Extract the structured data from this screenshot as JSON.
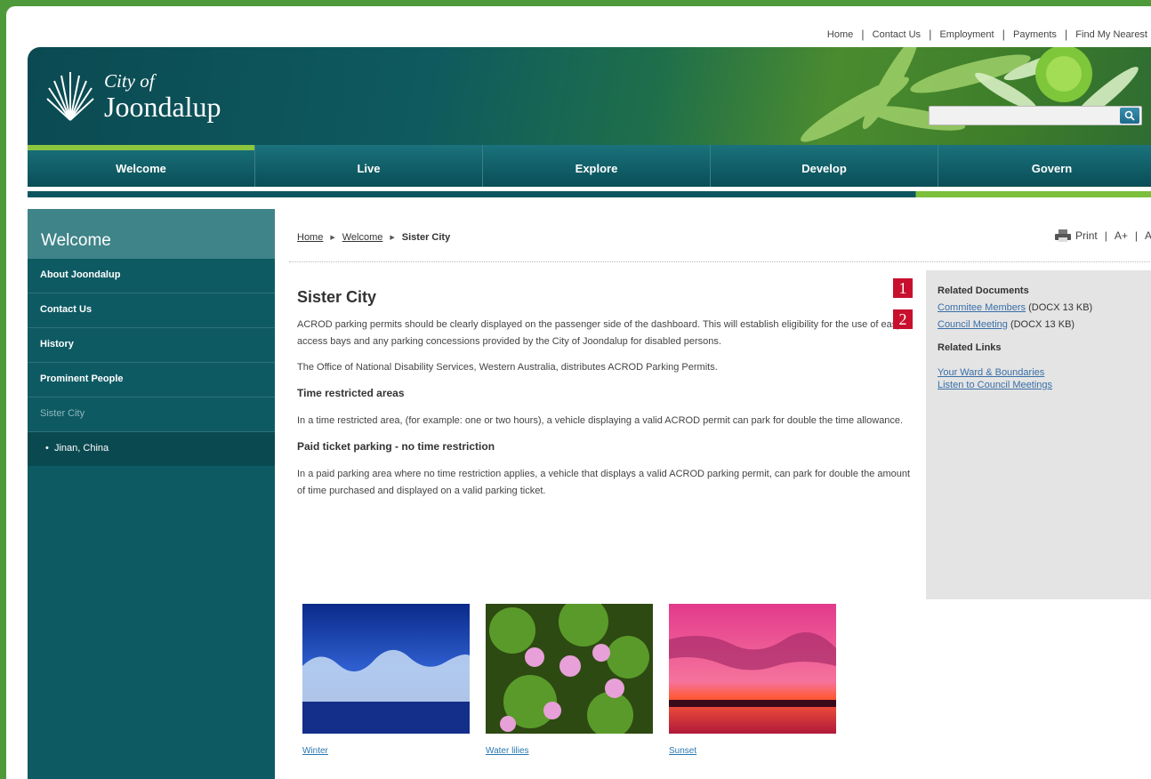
{
  "utility_nav": [
    "Home",
    "Contact Us",
    "Employment",
    "Payments",
    "Find My Nearest"
  ],
  "logo": {
    "line1": "City of",
    "line2": "Joondalup"
  },
  "search": {
    "placeholder": ""
  },
  "main_nav": [
    "Welcome",
    "Live",
    "Explore",
    "Develop",
    "Govern"
  ],
  "sidebar": {
    "title": "Welcome",
    "items": [
      "About Joondalup",
      "Contact Us",
      "History",
      "Prominent People",
      "Sister City"
    ],
    "sub_items": [
      "Jinan, China"
    ]
  },
  "breadcrumb": {
    "home": "Home",
    "welcome": "Welcome",
    "current": "Sister City"
  },
  "tools": {
    "print": "Print",
    "increase": "A+",
    "decrease": "A-"
  },
  "content": {
    "title": "Sister City",
    "p1": "ACROD parking permits should be clearly displayed on the passenger side of the dashboard. This will establish eligibility for the use of easy access bays and any parking concessions provided by the City of Joondalup for disabled persons.",
    "p2": "The Office of National Disability Services, Western Australia, distributes ACROD Parking Permits.",
    "h_time": "Time restricted areas",
    "p3": "In a time restricted area, (for example: one or two hours), a vehicle displaying a valid ACROD permit can park for double the time allowance.",
    "h_paid": "Paid ticket parking - no time restriction",
    "p4": "In a paid parking area where no time restriction applies, a vehicle that displays a valid ACROD parking permit, can park for double the amount of time purchased and displayed on a valid parking ticket."
  },
  "gallery": [
    "Winter",
    "Water lilies",
    "Sunset"
  ],
  "related": {
    "docs_title": "Related Documents",
    "docs": [
      {
        "name": "Commitee Members",
        "meta": "(DOCX 13 KB)"
      },
      {
        "name": "Council Meeting",
        "meta": "(DOCX 13 KB)"
      }
    ],
    "links_title": "Related Links",
    "links": [
      "Your Ward & Boundaries",
      "Listen to Council Meetings"
    ]
  },
  "markers": [
    "1",
    "2"
  ],
  "colors": {
    "accent_green": "#8cc63f",
    "teal": "#0e5a63",
    "frame_green": "#4e9a3a",
    "marker_red": "#c8102e"
  }
}
